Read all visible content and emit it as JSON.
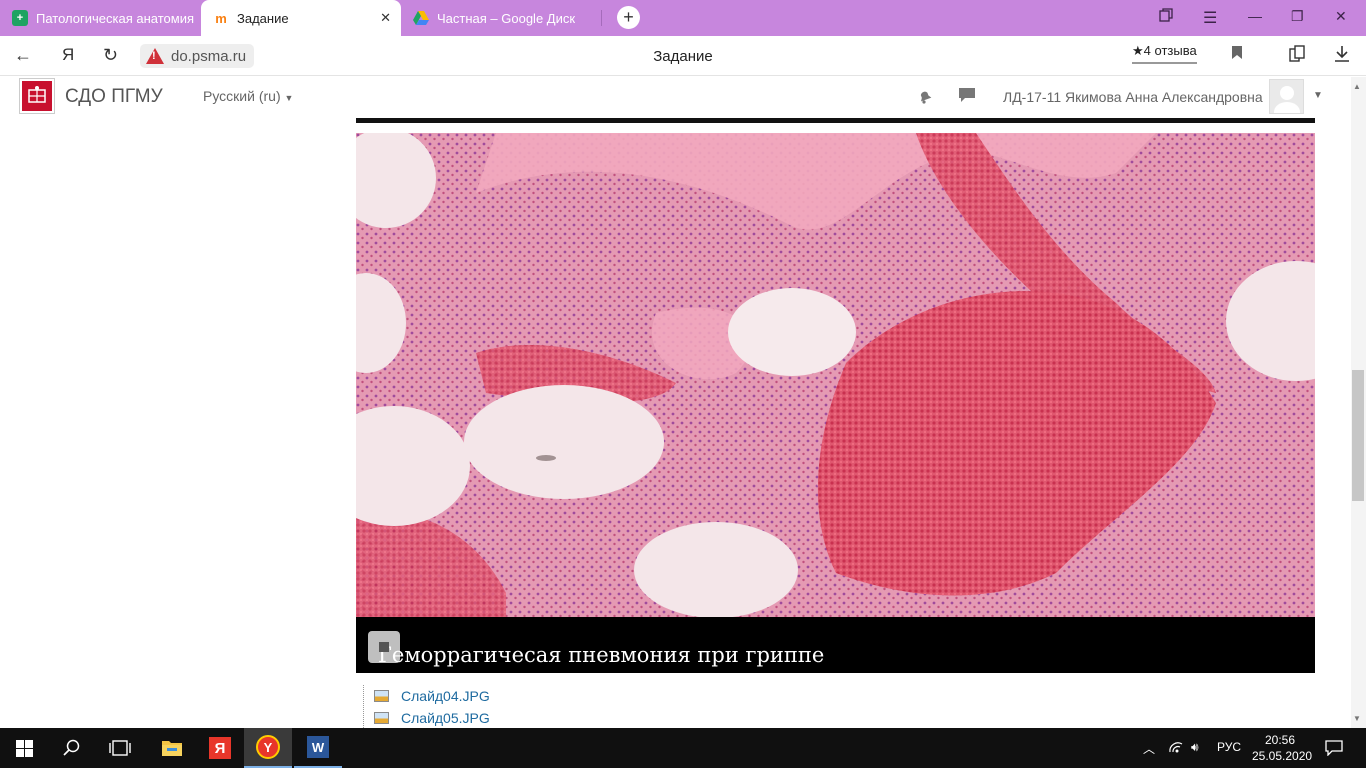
{
  "browser": {
    "tabs": [
      {
        "label": "Патологическая анатомия",
        "icon": "table-favicon",
        "active": false
      },
      {
        "label": "Задание",
        "icon": "moodle-favicon",
        "active": true
      },
      {
        "label": "Частная – Google Диск",
        "icon": "google-drive-favicon",
        "active": false
      }
    ],
    "address": {
      "url": "do.psma.ru",
      "page_title": "Задание",
      "reviews": "★4 отзыва",
      "yandex_glyph": "Я"
    }
  },
  "site": {
    "name": "СДО ПГМУ",
    "language": "Русский (ru)",
    "user_name": "ЛД-17-11 Якимова Анна Александровна"
  },
  "slide": {
    "caption": "Геморрагичесая пневмония при гриппе"
  },
  "files": [
    {
      "name": "Слайд04.JPG"
    },
    {
      "name": "Слайд05.JPG"
    }
  ],
  "taskbar": {
    "language": "РУС",
    "time": "20:56",
    "date": "25.05.2020"
  }
}
